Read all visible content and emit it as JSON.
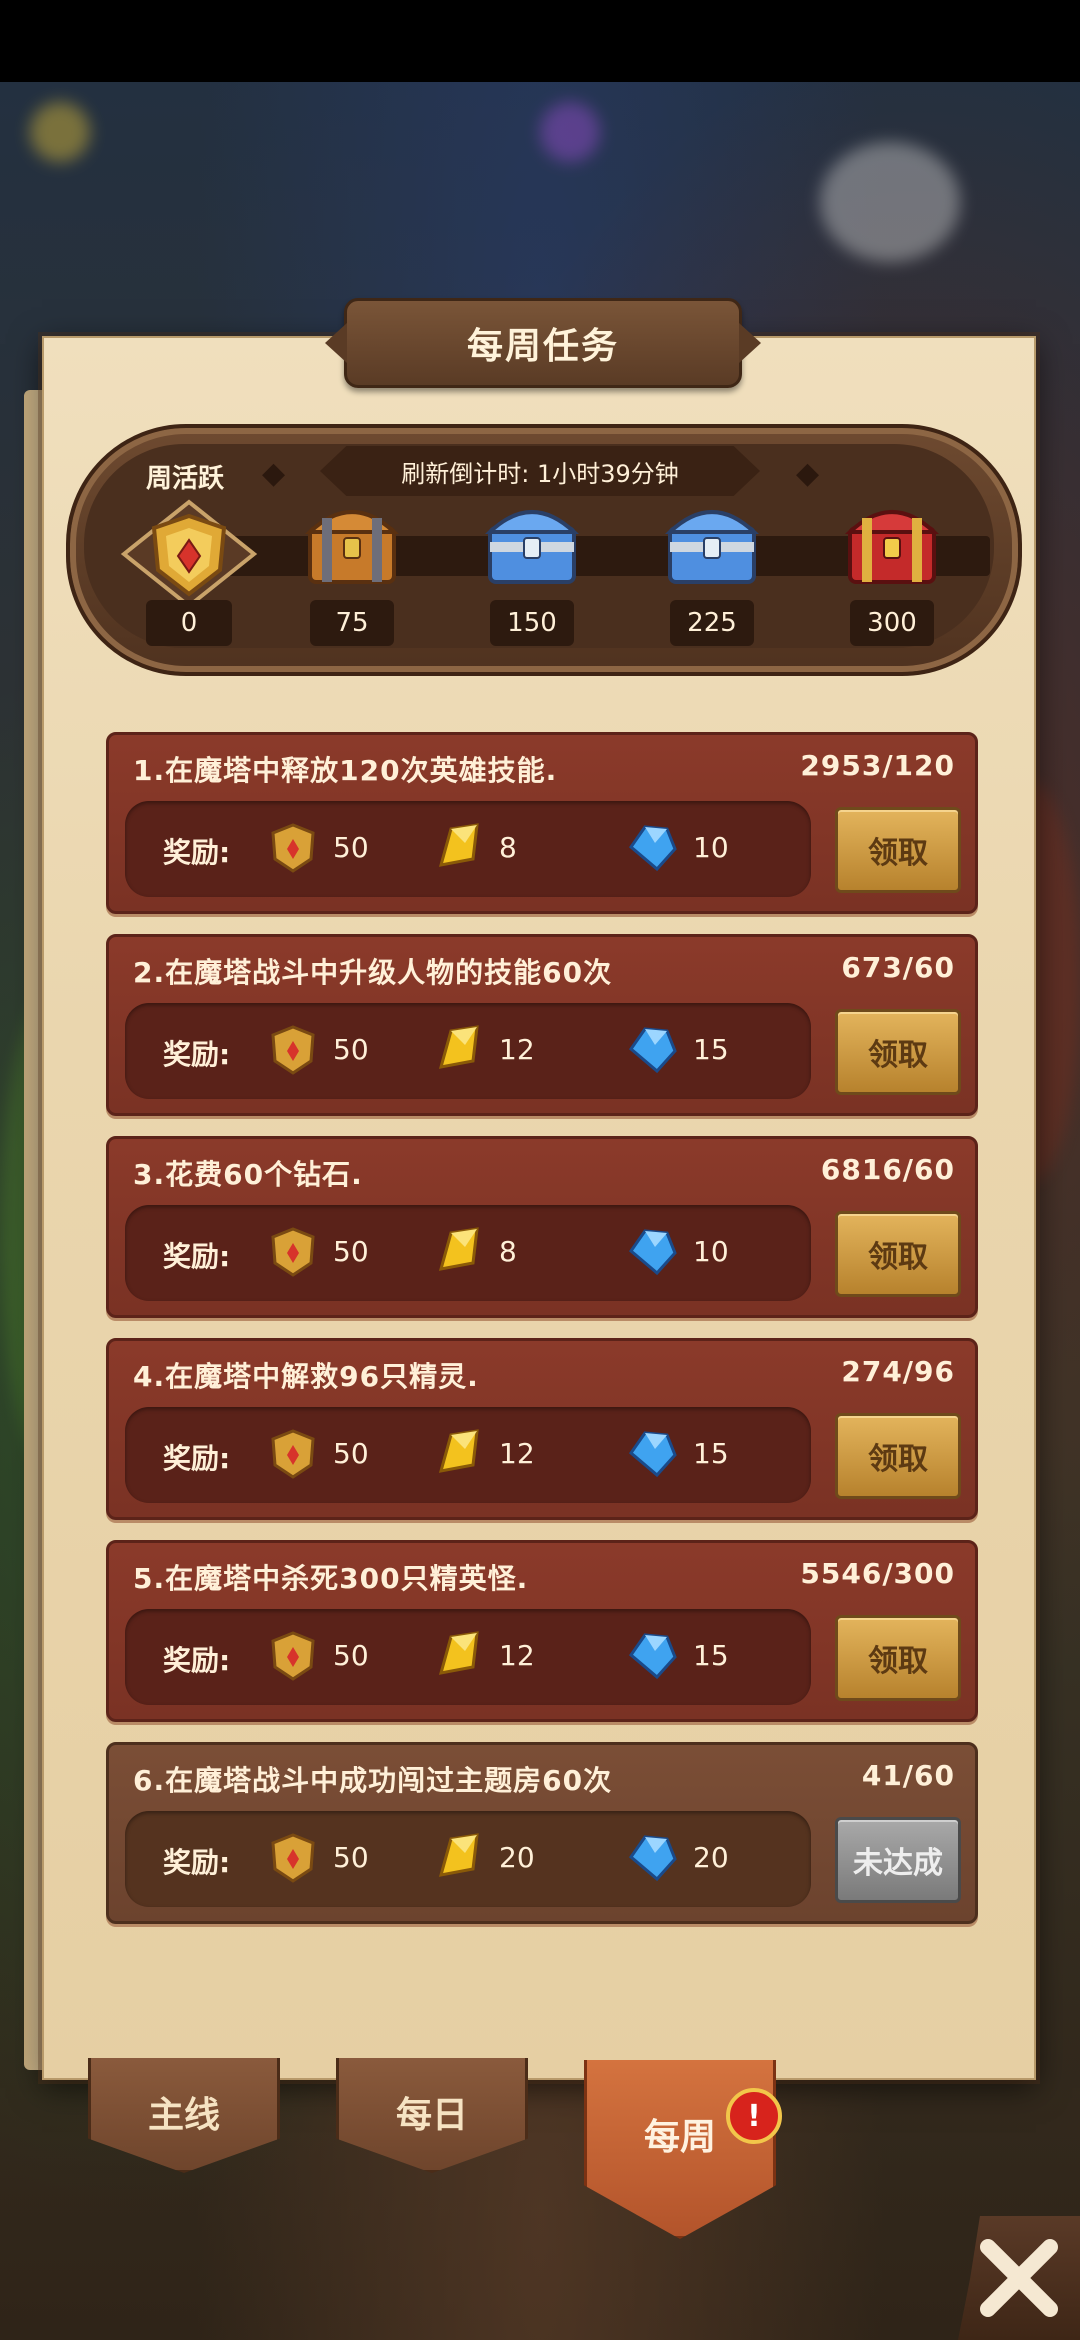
{
  "title": "每周任务",
  "activity": {
    "label": "周活跃",
    "refresh_text": "刷新倒计时: 1小时39分钟",
    "current_value": "0",
    "milestones": [
      "75",
      "150",
      "225",
      "300"
    ]
  },
  "reward_label": "奖励:",
  "tasks": [
    {
      "desc": "1.在魔塔中释放120次英雄技能.",
      "progress": "2953/120",
      "medal": "50",
      "gold": "8",
      "gem": "10",
      "button": "领取",
      "completed": true
    },
    {
      "desc": "2.在魔塔战斗中升级人物的技能60次",
      "progress": "673/60",
      "medal": "50",
      "gold": "12",
      "gem": "15",
      "button": "领取",
      "completed": true
    },
    {
      "desc": "3.花费60个钻石.",
      "progress": "6816/60",
      "medal": "50",
      "gold": "8",
      "gem": "10",
      "button": "领取",
      "completed": true
    },
    {
      "desc": "4.在魔塔中解救96只精灵.",
      "progress": "274/96",
      "medal": "50",
      "gold": "12",
      "gem": "15",
      "button": "领取",
      "completed": true
    },
    {
      "desc": "5.在魔塔中杀死300只精英怪.",
      "progress": "5546/300",
      "medal": "50",
      "gold": "12",
      "gem": "15",
      "button": "领取",
      "completed": true
    },
    {
      "desc": "6.在魔塔战斗中成功闯过主题房60次",
      "progress": "41/60",
      "medal": "50",
      "gold": "20",
      "gem": "20",
      "button": "未达成",
      "completed": false
    }
  ],
  "tabs": [
    {
      "label": "主线"
    },
    {
      "label": "每日"
    },
    {
      "label": "每周"
    }
  ],
  "alert_badge": "!",
  "colors": {
    "accent": "#d4733f",
    "task_bg": "#8b3a2a",
    "claim_gold": "#e3b45c"
  }
}
